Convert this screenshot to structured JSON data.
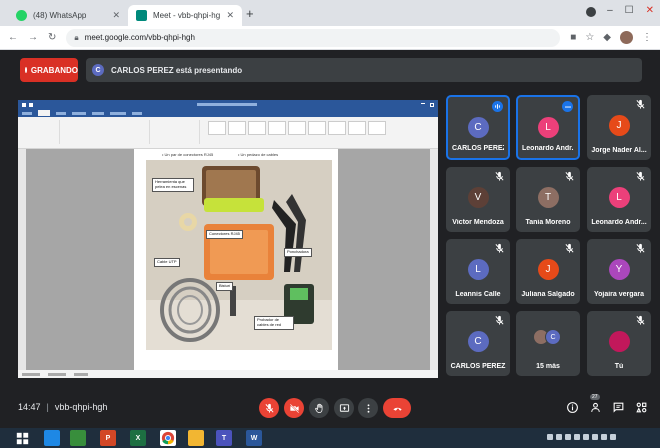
{
  "browser": {
    "tabs": [
      {
        "title": "(48) WhatsApp",
        "favicon_color": "#25d366"
      },
      {
        "title": "Meet - vbb-qhpi-hgh",
        "favicon_color": "#00897b"
      }
    ],
    "url": "meet.google.com/vbb-qhpi-hgh"
  },
  "meeting": {
    "recording_label": "GRABANDO",
    "presenter_initial": "C",
    "presenting_text": "CARLOS PEREZ está presentando",
    "time": "14:47",
    "code": "vbb-qhpi-hgh",
    "participant_count": "27"
  },
  "document": {
    "bullets": [
      "Un par de conectores RJ45",
      "Un pedazo de cables"
    ],
    "labels": {
      "tools": "Herramienta que pelea en escenas",
      "rj45": "Conectores RJ45",
      "crimper": "Ponchadora",
      "utp": "Cable UTP",
      "knife": "Bisturí",
      "tester": "Probador de cables de red"
    }
  },
  "participants": [
    {
      "name": "CARLOS PEREZ",
      "initial": "C",
      "color": "#5c6bc0",
      "active": true,
      "status": "speaking"
    },
    {
      "name": "Leonardo Andr...",
      "initial": "L",
      "color": "#ec407a",
      "active": true,
      "status": "more"
    },
    {
      "name": "Jorge Nader Al...",
      "initial": "J",
      "color": "#e64a19",
      "active": false,
      "status": "muted"
    },
    {
      "name": "Victor Mendoza",
      "initial": "V",
      "color": "#5d4037",
      "active": false,
      "status": "muted"
    },
    {
      "name": "Tania Moreno",
      "initial": "T",
      "color": "#8d6e63",
      "active": false,
      "status": "muted"
    },
    {
      "name": "Leonardo Andr...",
      "initial": "L",
      "color": "#ec407a",
      "active": false,
      "status": "muted"
    },
    {
      "name": "Leannis Calle",
      "initial": "L",
      "color": "#5c6bc0",
      "active": false,
      "status": "muted"
    },
    {
      "name": "Juliana Salgado",
      "initial": "J",
      "color": "#e64a19",
      "active": false,
      "status": "muted"
    },
    {
      "name": "Yojaira vergara",
      "initial": "Y",
      "color": "#ab47bc",
      "active": false,
      "status": "muted"
    },
    {
      "name": "CARLOS PEREZ",
      "initial": "C",
      "color": "#5c6bc0",
      "active": false,
      "status": "muted"
    },
    {
      "name": "15 más",
      "initial": "",
      "color": "#3c4043",
      "active": false,
      "status": "none"
    },
    {
      "name": "Tú",
      "initial": "",
      "color": "#c2185b",
      "active": false,
      "status": "muted"
    }
  ]
}
